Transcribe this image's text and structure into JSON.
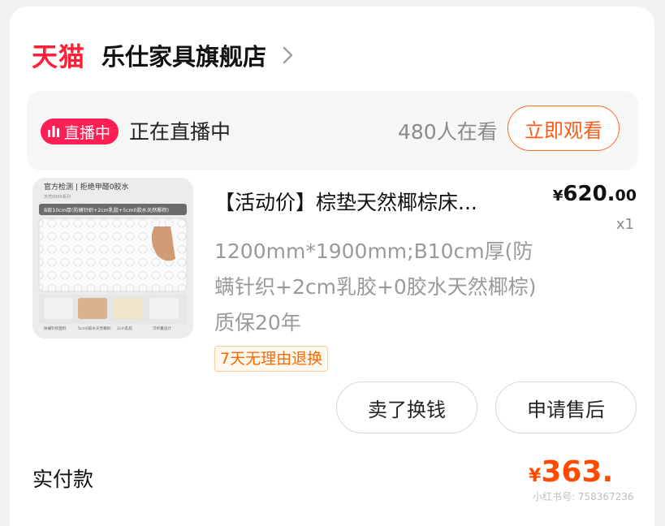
{
  "shop": {
    "platform_logo": "天猫",
    "name": "乐仕家具旗舰店",
    "chevron_icon": "chevron-right-icon"
  },
  "live": {
    "badge": "直播中",
    "status_text": "正在直播中",
    "viewers": "480人在看",
    "watch_button": "立即观看"
  },
  "product": {
    "title": "【活动价】棕垫天然椰棕床...",
    "price_symbol": "¥",
    "price_int": "620.",
    "price_dec": "00",
    "quantity": "x1",
    "spec": "1200mm*1900mm;B10cm厚(防螨针织+2cm乳胶+0胶水天然椰棕)质保20年",
    "return_policy": "7天无理由退换",
    "image_text": {
      "header": "官方检测 | 拒绝甲醛0胶水",
      "sub": "天然0000系列",
      "band": "B款10cm厚(防螨针织+2cm乳胶+5cm0胶水天然椰棕)",
      "items": [
        "防螨针织面料",
        "5cm0胶水天然椰棕",
        "2cm乳胶",
        "可折叠设计"
      ]
    }
  },
  "actions": {
    "sell_button": "卖了换钱",
    "after_sale_button": "申请售后"
  },
  "payment": {
    "label": "实付款",
    "symbol": "¥",
    "amount": "363.",
    "watermark": "小红书号: 758367236"
  },
  "colors": {
    "tmall_red": "#ff1f37",
    "accent_orange": "#ff5a1a",
    "live_badge": "#ff1f55"
  }
}
